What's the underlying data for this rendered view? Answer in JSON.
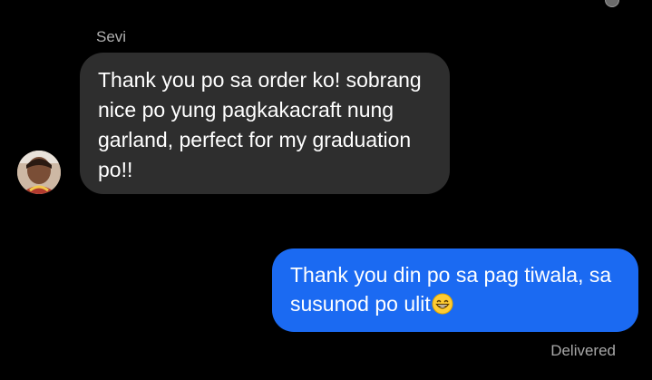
{
  "thread": {
    "sender_name": "Sevi"
  },
  "messages": [
    {
      "direction": "incoming",
      "text": "Thank you po sa order ko! sobrang nice po yung pagkakacraft nung garland, perfect for my graduation po!!"
    },
    {
      "direction": "outgoing",
      "text": "Thank you din po sa pag tiwala, sa susunod po ulit",
      "emoji": "grinning-face-with-smiling-eyes-emoji"
    }
  ],
  "status": {
    "label": "Delivered"
  },
  "colors": {
    "background": "#000000",
    "incoming_bubble": "#2e2e2e",
    "outgoing_bubble": "#1b6af2",
    "meta_text": "#a8a8a8"
  }
}
